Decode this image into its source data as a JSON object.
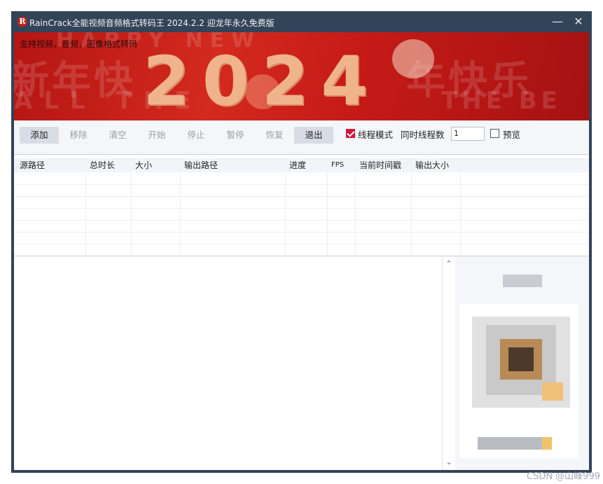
{
  "window": {
    "title": "RainCrack全能视频音频格式转码王 2024.2.2 迎龙年永久免费版",
    "icon": "R",
    "minimize_glyph": "—",
    "close_glyph": "✕"
  },
  "banner": {
    "support_text": "支持视频，音频，图像格式转码",
    "year": "2024",
    "bg_text_1": "新年快",
    "bg_text_2": "年快乐",
    "bg_text_3": "ALL THE",
    "bg_text_4": "THE BE",
    "bg_text_5": "HAPPY NEW",
    "primary_color": "#c51a17",
    "accent_color": "#f0b48c"
  },
  "toolbar": {
    "buttons": [
      {
        "label": "添加",
        "enabled": true
      },
      {
        "label": "移除",
        "enabled": false
      },
      {
        "label": "清空",
        "enabled": false
      },
      {
        "label": "开始",
        "enabled": false
      },
      {
        "label": "停止",
        "enabled": false
      },
      {
        "label": "暂停",
        "enabled": false
      },
      {
        "label": "恢复",
        "enabled": false
      },
      {
        "label": "退出",
        "enabled": true
      }
    ],
    "thread_mode_label": "线程模式",
    "thread_mode_checked": true,
    "concurrent_label": "同时线程数",
    "concurrent_value": "1",
    "preview_label": "预览",
    "preview_checked": false,
    "check_color": "#d2153b"
  },
  "table": {
    "columns": [
      "源路径",
      "总时长",
      "大小",
      "输出路径",
      "进度",
      "FPS",
      "当前时间戳",
      "输出大小"
    ],
    "rows": []
  },
  "log": {
    "text": "",
    "scroll_up": "⌃",
    "scroll_down": "⌄"
  },
  "watermark": "CSDN @山峰999"
}
